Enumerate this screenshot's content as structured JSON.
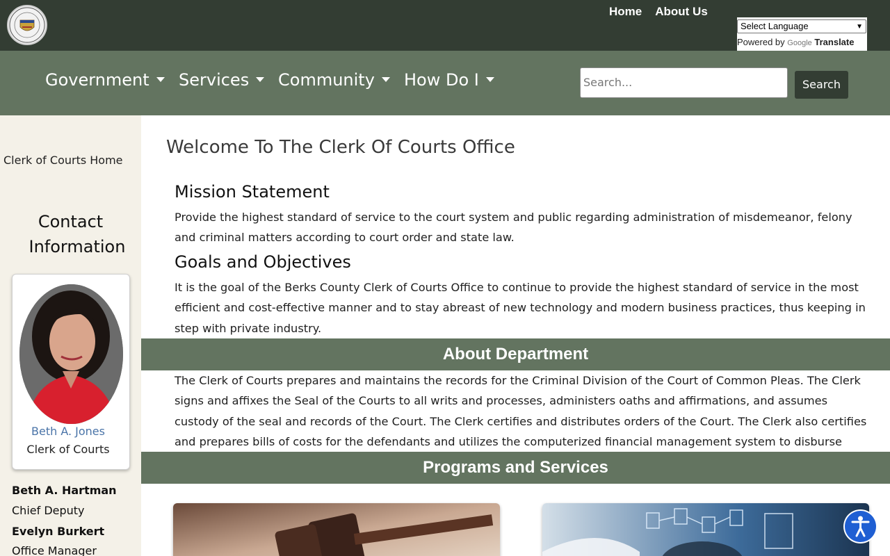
{
  "header": {
    "top_links": [
      "Home",
      "About Us"
    ],
    "translate": {
      "select_label": "Select Language",
      "powered_by": "Powered by",
      "google": "Google",
      "translate": "Translate"
    }
  },
  "nav": {
    "items": [
      "Government",
      "Services",
      "Community",
      "How Do I"
    ],
    "search_placeholder": "Search...",
    "search_button": "Search"
  },
  "sidebar": {
    "home_link": "Clerk of Courts Home",
    "contact_title": "Contact Information",
    "official": {
      "name": "Beth A. Jones",
      "role": "Clerk of Courts"
    },
    "staff": [
      {
        "name": "Beth A. Hartman",
        "role": "Chief Deputy"
      },
      {
        "name": "Evelyn Burkert",
        "role": "Office Manager"
      }
    ]
  },
  "main": {
    "title": "Welcome To The Clerk Of Courts Office",
    "mission_heading": "Mission Statement",
    "mission_text": "Provide the highest standard of service to the court system and public regarding administration of misdemeanor, felony and criminal matters according to court order and state law.",
    "goals_heading": "Goals and Objectives",
    "goals_text": "It is the goal of the Berks County Clerk of Courts Office to continue to provide the highest standard of service in the most efficient and cost-effective manner and to stay abreast of new technology and modern business practices, thus keeping in step with private industry.",
    "about_heading": "About Department",
    "about_text": "The Clerk of Courts prepares and maintains the records for the Criminal Division of the Court of Common Pleas. The Clerk signs and affixes the Seal of the Courts to all writs and processes, administers oaths and affirmations, and assumes custody of the seal and records of the Court. The Clerk certifies and distributes orders of the Court. The Clerk also certifies and prepares bills of costs for the defendants and utilizes the computerized financial management system to disburse fines, costs and restitution.",
    "programs_heading": "Programs and Services"
  },
  "colors": {
    "topbar": "#333d33",
    "navbar": "#637460",
    "sidebar": "#f4f1e8",
    "link": "#4a74a8",
    "accessibility": "#1f5fd3"
  }
}
